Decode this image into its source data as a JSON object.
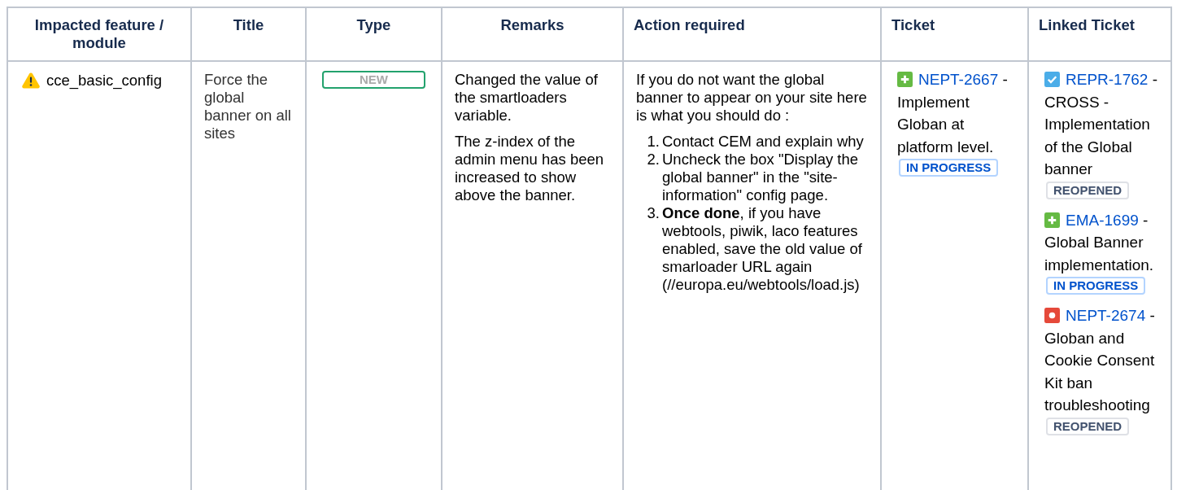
{
  "table": {
    "columns": [
      "Impacted feature / module",
      "Title",
      "Type",
      "Remarks",
      "Action required",
      "Ticket",
      "Linked Ticket"
    ],
    "rows": [
      {
        "feature": {
          "warning": true,
          "name": "cce_basic_config"
        },
        "title": "Force the global banner on all sites",
        "type": {
          "label": "NEW",
          "kind": "new"
        },
        "remarks": [
          "Changed the value of the smartloaders variable.",
          "The z-index of the admin menu has been increased to show above the banner."
        ],
        "action": {
          "intro": "If you do not want the global banner to appear on your site here is what you should do :",
          "steps": [
            {
              "number": "1.",
              "text": "Contact CEM and explain why"
            },
            {
              "number": "2.",
              "text": "Uncheck the box \"Display the global banner\" in the \"site-information\" config page."
            },
            {
              "number": "3.",
              "text": "**Once done**, if you have webtools, piwik, laco features enabled, save the old value of smarloader URL again (//europa.eu/webtools/load.js)"
            }
          ]
        },
        "ticket": [
          {
            "kind": "new_feature",
            "key": "NEPT-2667",
            "summary": "- Implement Globan at platform level.",
            "status": {
              "label": "IN PROGRESS",
              "kind": "inprogress"
            }
          }
        ],
        "linked_tickets": [
          {
            "kind": "task",
            "key": "REPR-1762",
            "summary": "- CROSS - Implementation of the Global banner",
            "status": {
              "label": "REOPENED",
              "kind": "reopened"
            }
          },
          {
            "kind": "new_feature",
            "key": "EMA-1699",
            "summary": "- Global Banner implementation.",
            "status": {
              "label": "IN PROGRESS",
              "kind": "inprogress"
            }
          },
          {
            "kind": "bug",
            "key": "NEPT-2674",
            "summary": "- Globan and Cookie Consent Kit ban troubleshooting",
            "status": {
              "label": "REOPENED",
              "kind": "reopened"
            }
          }
        ]
      }
    ]
  }
}
